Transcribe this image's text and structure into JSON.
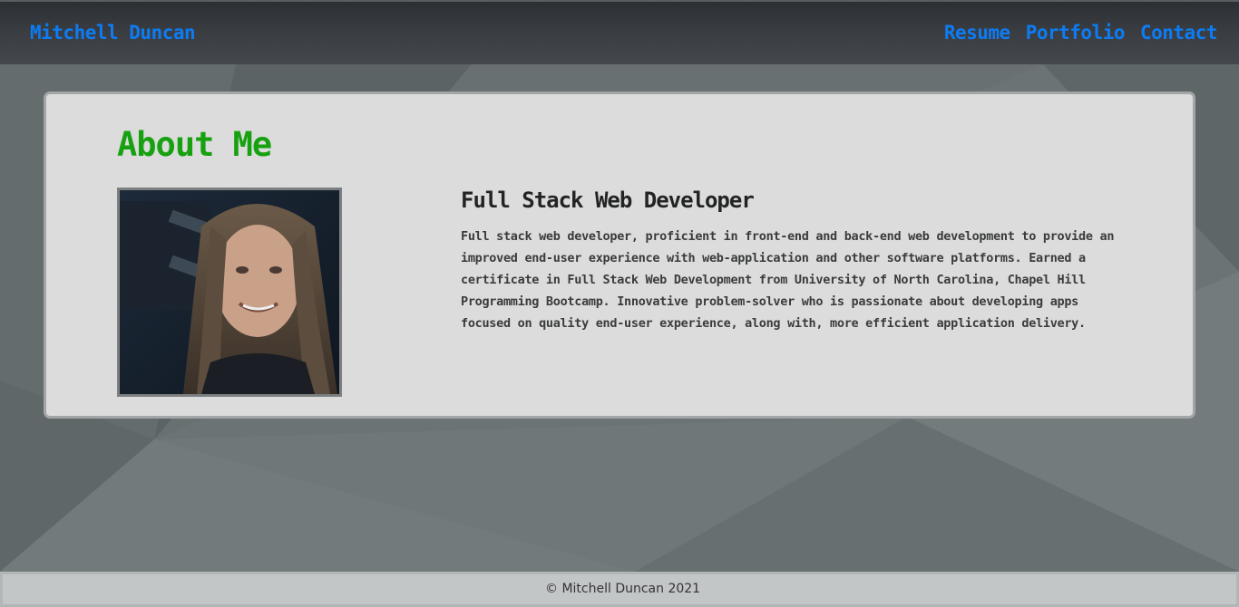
{
  "navbar": {
    "brand": "Mitchell Duncan",
    "links": [
      {
        "label": "Resume"
      },
      {
        "label": "Portfolio"
      },
      {
        "label": "Contact"
      }
    ]
  },
  "about": {
    "title": "About Me",
    "role": "Full Stack Web Developer",
    "bio": "Full stack web developer, proficient in front-end and back-end web development to provide an improved end-user experience with web-application and other software platforms. Earned a certificate in Full Stack Web Development from University of North Carolina, Chapel Hill Programming Bootcamp. Innovative problem-solver who is passionate about developing apps focused on quality end-user experience, along with, more efficient application delivery."
  },
  "footer": {
    "copyright": "© Mitchell Duncan 2021"
  },
  "colors": {
    "link": "#0d7cf2",
    "heading_green": "#17a111",
    "card_bg": "#dcdcdc",
    "navbar_bg": "#3a3d42"
  }
}
